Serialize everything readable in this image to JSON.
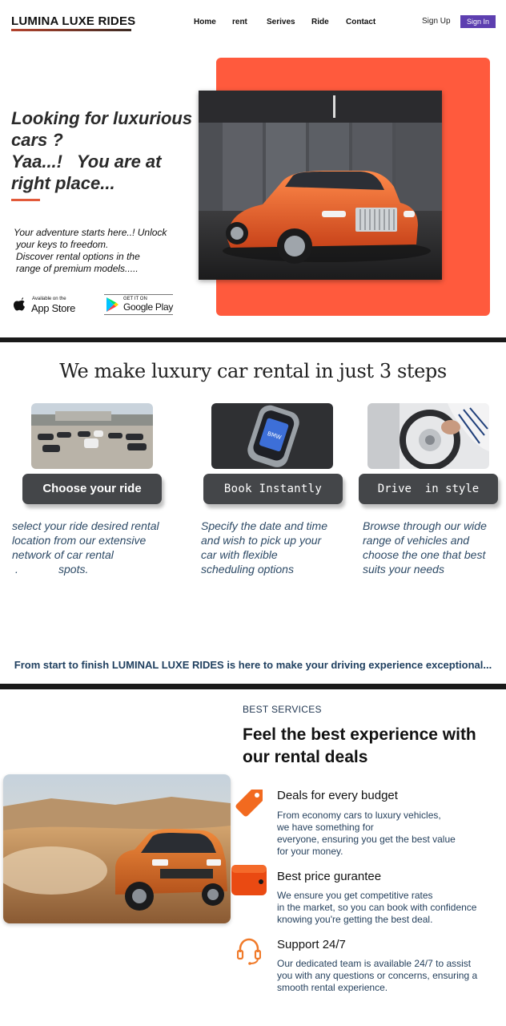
{
  "header": {
    "logo": "LUMINA LUXE RIDES",
    "nav": [
      "Home",
      "rent",
      "Serives",
      "Ride",
      "Contact"
    ],
    "sign_up": "Sign Up",
    "sign_in": "Sign In"
  },
  "hero": {
    "title_line1": "Looking for luxurious",
    "title_line2": "cars ?",
    "title_line3": "Yaa...!   You are at",
    "title_line4": "right place...",
    "text_line1": "Your adventure starts here..! Unlock",
    "text_line2": "your keys to freedom.",
    "text_line3": "Discover rental options in the",
    "text_line4": "range of premium models.....",
    "app_store_small": "Available on the",
    "app_store_big": "App Store",
    "google_play_small": "GET IT ON",
    "google_play_big": "Google Play"
  },
  "steps": {
    "title": "We make luxury car rental in just 3 steps",
    "items": [
      {
        "button": "Choose your ride",
        "desc": [
          "select your ride desired rental",
          "location from our extensive",
          "network of car rental",
          "spots."
        ]
      },
      {
        "button": "Book Instantly",
        "desc": [
          "Specify the date and time",
          "and wish to pick up your",
          "car with flexible",
          "scheduling options"
        ]
      },
      {
        "button": "Drive  in style",
        "desc": [
          "Browse through our wide",
          "range of vehicles and",
          "choose the one that best",
          "suits your needs"
        ]
      }
    ],
    "tagline": "From start to finish LUMINAL LUXE RIDES is here to make your driving experience exceptional..."
  },
  "services": {
    "kicker": "BEST SERVICES",
    "title_line1": "Feel the best experience with",
    "title_line2": "our rental deals",
    "features": [
      {
        "heading": "Deals for every budget",
        "icon": "price-tag-icon",
        "text": [
          "From economy cars to luxury vehicles,",
          "we have something for",
          "everyone, ensuring you get the best value",
          "for your money."
        ]
      },
      {
        "heading": "Best price gurantee",
        "icon": "wallet-icon",
        "text": [
          "We ensure you get competitive rates",
          "in the market, so you can book with confidence",
          "knowing you're getting the best deal."
        ]
      },
      {
        "heading": "Support 24/7",
        "icon": "headset-icon",
        "text": [
          "Our dedicated team is available 24/7 to assist",
          "you with any questions or concerns, ensuring a",
          "smooth rental experience."
        ]
      }
    ]
  },
  "colors": {
    "accent_orange": "#ff5a3d",
    "sign_in_purple": "#5d3fb0",
    "step_button": "#444649",
    "text_blue": "#2d4a66"
  }
}
